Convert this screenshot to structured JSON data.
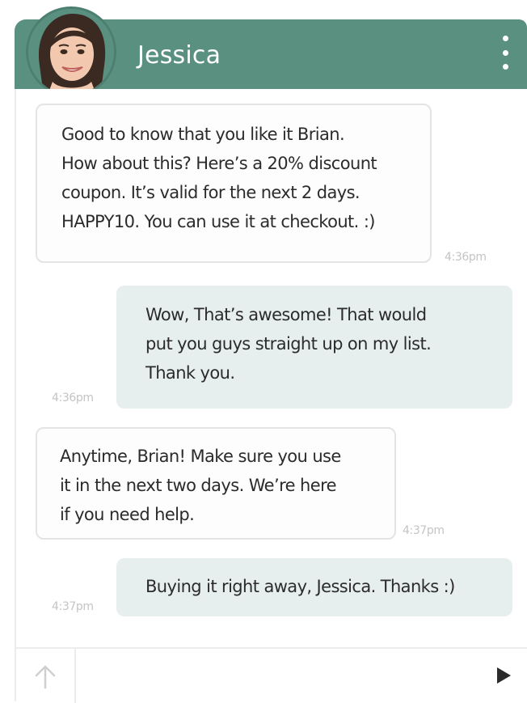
{
  "header": {
    "contact_name": "Jessica",
    "avatar_icon": "contact-avatar",
    "menu_icon": "more-vertical-icon",
    "header_color": "#5a9080"
  },
  "messages": [
    {
      "direction": "incoming",
      "lines": [
        "Good to know that you like it Brian.",
        "How about this? Here’s a 20% discount",
        "coupon. It’s valid for the next 2 days.",
        "HAPPY10. You can use it at checkout. :)"
      ],
      "time": "4:36pm"
    },
    {
      "direction": "outgoing",
      "lines": [
        "Wow, That’s awesome! That would",
        "put you guys straight up on my list.",
        "Thank you."
      ],
      "time": "4:36pm"
    },
    {
      "direction": "incoming",
      "lines": [
        "Anytime, Brian! Make sure you use",
        "it in the next two days. We’re here",
        "if you need help."
      ],
      "time": "4:37pm"
    },
    {
      "direction": "outgoing",
      "lines": [
        "Buying it right away, Jessica. Thanks :)"
      ],
      "time": "4:37pm"
    }
  ],
  "composer": {
    "placeholder": "",
    "value": "",
    "attach_icon": "arrow-up-icon",
    "send_icon": "send-triangle-icon"
  },
  "colors": {
    "incoming_bubble": "#fdfdfd",
    "outgoing_bubble": "#e7eeee",
    "timestamp": "#c4c4c4"
  }
}
